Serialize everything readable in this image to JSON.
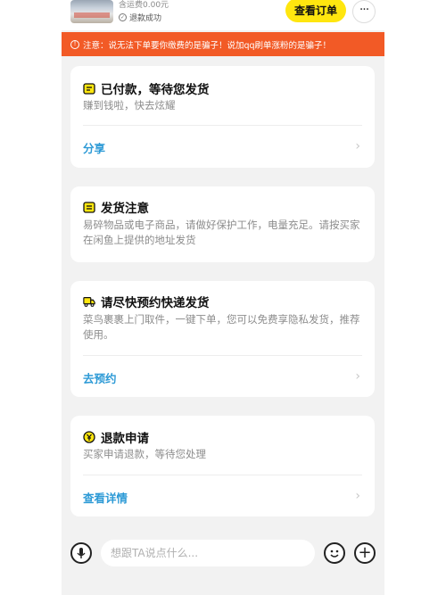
{
  "header": {
    "shipping_text": "含运费0.00元",
    "refund_status": "退款成功",
    "view_order_label": "查看订单",
    "more_label": "···"
  },
  "warning": {
    "text": "注意：说无法下单要你缴费的是骗子！说加qq刷单涨粉的是骗子！"
  },
  "cards": [
    {
      "title": "已付款，等待您发货",
      "desc": "赚到钱啦，快去炫耀",
      "link": "分享"
    },
    {
      "title": "发货注意",
      "desc": "易碎物品或电子商品，请做好保护工作，电量充足。请按买家在闲鱼上提供的地址发货"
    },
    {
      "title": "请尽快预约快递发货",
      "desc": "菜鸟裹裹上门取件，一键下单，您可以免费享隐私发货，推荐使用。",
      "link": "去预约"
    },
    {
      "title": "退款申请",
      "desc": "买家申请退款，等待您处理",
      "link": "查看详情"
    }
  ],
  "chat": {
    "placeholder": "想跟TA说点什么..."
  },
  "icons": [
    "clipboard-icon",
    "notice-icon",
    "truck-icon",
    "refund-coin-icon",
    "mic-icon",
    "emoji-icon",
    "plus-icon",
    "chevron-right-icon",
    "warning-icon",
    "check-circle-icon",
    "more-icon"
  ],
  "colors": {
    "accent_yellow": "#ffe60f",
    "warning_bg": "#f25a26",
    "link_blue": "#2d9ad6",
    "page_bg": "#f2f2f2"
  }
}
